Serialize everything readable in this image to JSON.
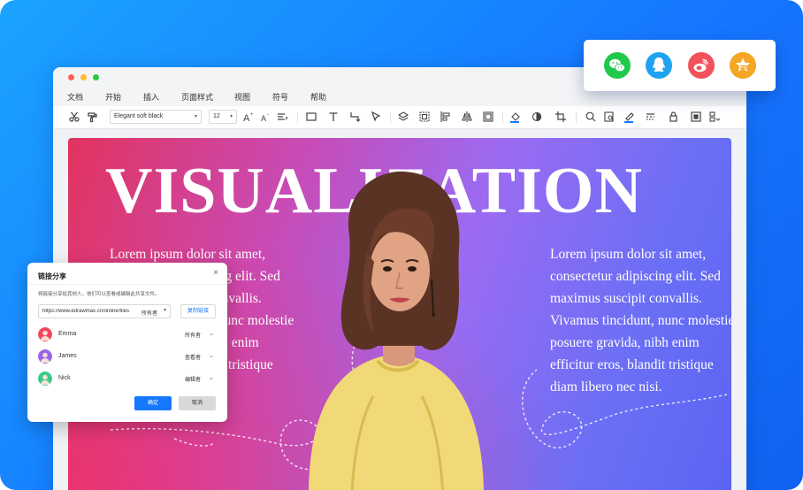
{
  "menu": [
    "文档",
    "开始",
    "插入",
    "页面样式",
    "视图",
    "符号",
    "帮助"
  ],
  "toolbar": {
    "font": "Elegant soft black",
    "size": "12"
  },
  "poster": {
    "headline": "VISUALIZATION",
    "body_left": "Lorem ipsum dolor sit amet,\nconsectetur adipiscing elit. Sed\nmaximus suscipit convallis.\nVivamus tincidunt, nunc molestie\nposuere gravida, nibh enim\nefficitur eros, blandit tristique\ndiam libero nec nisi.",
    "body_right": "Lorem ipsum dolor sit amet,\nconsectetur adipiscing elit. Sed\nmaximus suscipit convallis.\nVivamus tincidunt, nunc molestie\nposuere gravida, nibh enim\nefficitur eros, blandit tristique\ndiam libero nec nisi."
  },
  "share": {
    "title": "链接分享",
    "description": "将链接分享给其他人，他们可以查看或编辑此共享文件。",
    "url": "https://www.edrawmax.cn/online/files",
    "url_permission": "所有者",
    "copy_label": "复制链接",
    "members": [
      {
        "name": "Emma",
        "role": "所有者",
        "color": "#f2465a"
      },
      {
        "name": "James",
        "role": "查看者",
        "color": "#9a63e8"
      },
      {
        "name": "Nick",
        "role": "编辑者",
        "color": "#3cc98c"
      }
    ],
    "ok_label": "确定",
    "cancel_label": "取消"
  },
  "social": [
    {
      "icon": "wechat-icon",
      "color": "#1fc94b"
    },
    {
      "icon": "qq-icon",
      "color": "#1fa3f0"
    },
    {
      "icon": "weibo-icon",
      "color": "#f0515b"
    },
    {
      "icon": "qzone-icon",
      "color": "#f5a623"
    }
  ]
}
